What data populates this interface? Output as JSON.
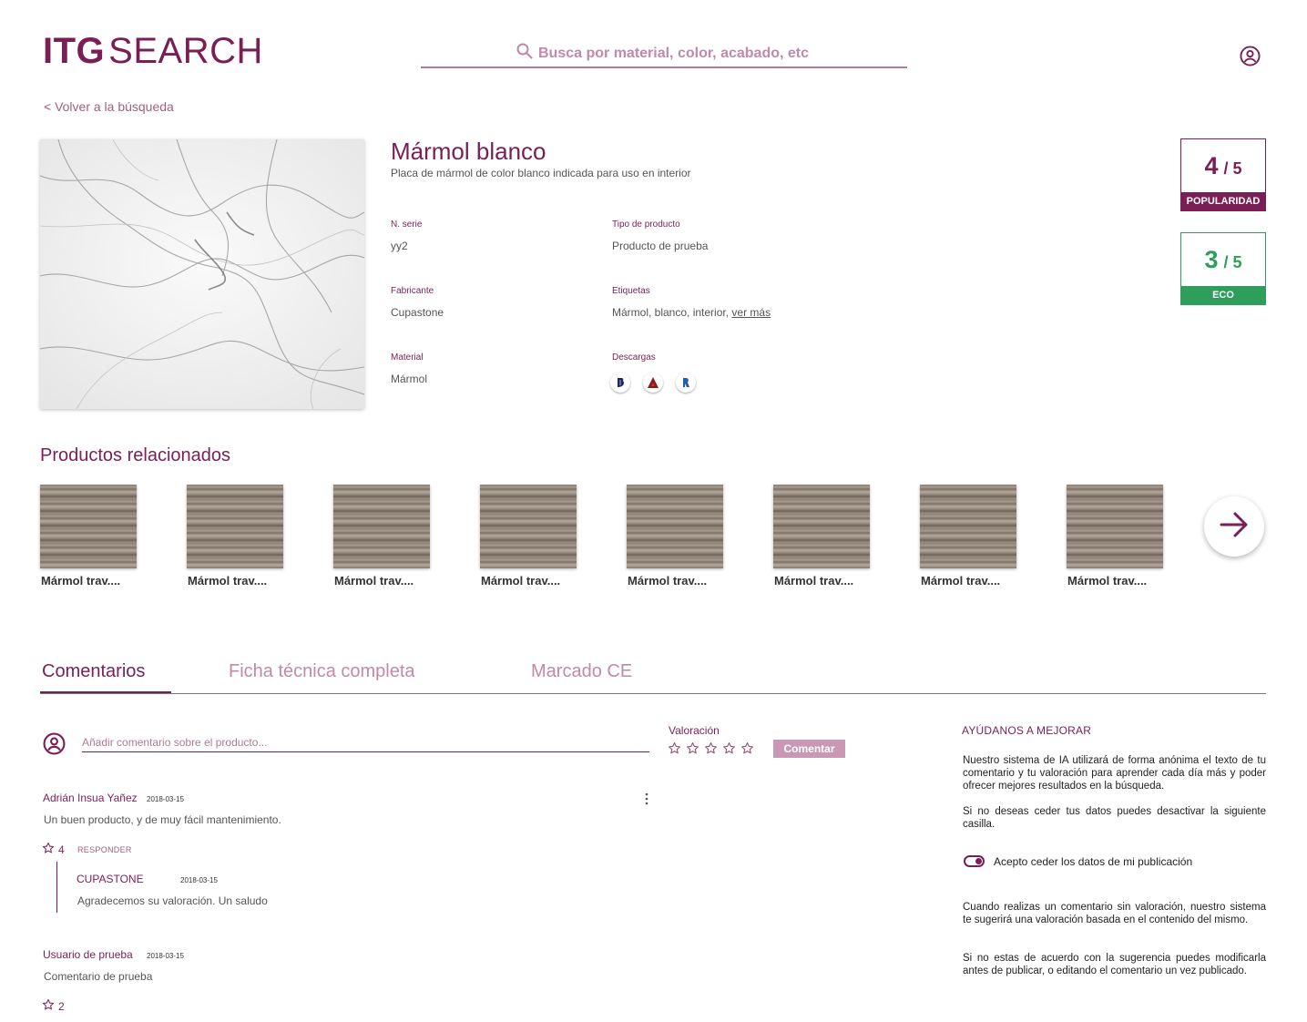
{
  "header": {
    "logo_bold": "ITG",
    "logo_light": "SEARCH",
    "search_placeholder": "Busca por material, color, acabado, etc"
  },
  "back_link": "< Volver a la búsqueda",
  "product": {
    "title": "Mármol blanco",
    "description": "Placa de mármol de color blanco indicada para uso en interior",
    "fields": {
      "serie_label": "N. serie",
      "serie_value": "yy2",
      "tipo_label": "Tipo de producto",
      "tipo_value": "Producto de prueba",
      "fabricante_label": "Fabricante",
      "fabricante_value": "Cupastone",
      "etiquetas_label": "Etiquetas",
      "etiquetas_value": "Mármol, blanco, interior,",
      "etiquetas_more": "ver más",
      "material_label": "Material",
      "material_value": "Mármol",
      "descargas_label": "Descargas"
    },
    "downloads": [
      {
        "icon": "bim-download-icon",
        "color": "#1a2a5c"
      },
      {
        "icon": "autocad-download-icon",
        "color": "#8b1a1a"
      },
      {
        "icon": "revit-download-icon",
        "color": "#1f5fb5"
      }
    ]
  },
  "scores": {
    "popularity": {
      "value": "4",
      "max": "/ 5",
      "label": "POPULARIDAD",
      "color": "#7a1f55"
    },
    "eco": {
      "value": "3",
      "max": "/ 5",
      "label": "ECO",
      "color": "#2e9e5a"
    }
  },
  "related": {
    "title": "Productos relacionados",
    "items": [
      {
        "name": "Mármol trav...."
      },
      {
        "name": "Mármol trav...."
      },
      {
        "name": "Mármol trav...."
      },
      {
        "name": "Mármol trav...."
      },
      {
        "name": "Mármol trav...."
      },
      {
        "name": "Mármol trav...."
      },
      {
        "name": "Mármol trav...."
      },
      {
        "name": "Mármol trav...."
      }
    ]
  },
  "tabs": [
    {
      "label": "Comentarios",
      "active": true
    },
    {
      "label": "Ficha técnica completa",
      "active": false
    },
    {
      "label": "Marcado CE",
      "active": false
    }
  ],
  "comment_form": {
    "placeholder": "Añadir comentario sobre el producto...",
    "rating_label": "Valoración",
    "submit_label": "Comentar"
  },
  "comments": [
    {
      "author": "Adrián Insua Yañez",
      "date": "2018-03-15",
      "text": "Un buen producto, y de muy fácil mantenimiento.",
      "likes": "4",
      "reply_label": "RESPONDER",
      "reply": {
        "author": "CUPASTONE",
        "date": "2018-03-15",
        "text": "Agradecemos su valoración. Un saludo"
      }
    },
    {
      "author": "Usuario de prueba",
      "date": "2018-03-15",
      "text": "Comentario de prueba",
      "likes": "2"
    }
  ],
  "help": {
    "title": "AYÚDANOS A MEJORAR",
    "p1": "Nuestro sistema de IA utilizará de forma anónima el texto de tu comentario y tu valoración para aprender cada día más y poder ofrecer mejores resultados en la búsqueda.",
    "p2": "Si no deseas ceder tus datos puedes desactivar la siguiente casilla.",
    "toggle_label": "Acepto ceder los datos de mi publicación",
    "p3": "Cuando realizas un comentario sin valoración, nuestro sistema te sugerirá una valoración basada en el contenido del mismo.",
    "p4": "Si no estas de acuerdo con la sugerencia puedes modificarla antes de publicar, o editando el comentario un vez publicado."
  }
}
